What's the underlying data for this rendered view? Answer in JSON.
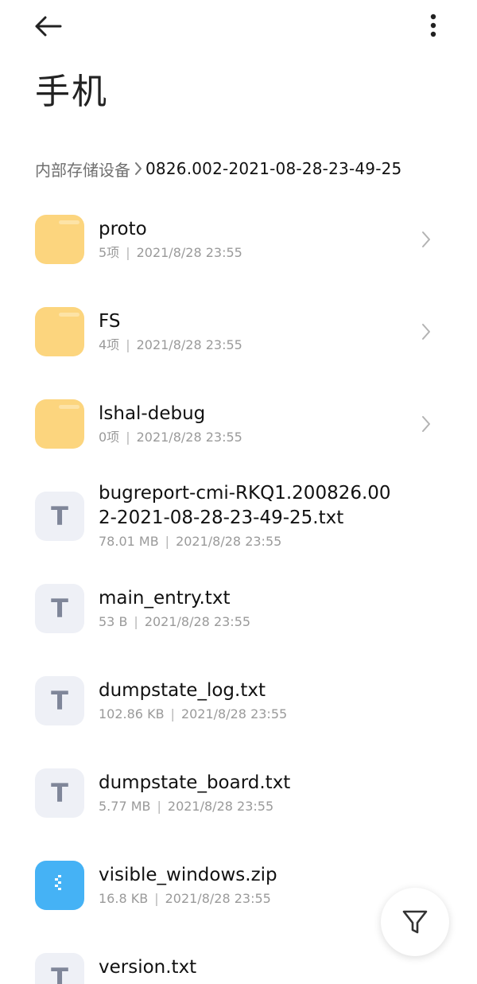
{
  "header": {
    "title": "手机",
    "back_icon": "arrow-left-icon",
    "more_icon": "more-vertical-icon"
  },
  "breadcrumb": {
    "root": "内部存储设备",
    "current": "0826.002-2021-08-28-23-49-25"
  },
  "files": [
    {
      "name": "proto",
      "size": "5项",
      "date": "2021/8/28 23:55",
      "kind": "folder"
    },
    {
      "name": "FS",
      "size": "4项",
      "date": "2021/8/28 23:55",
      "kind": "folder"
    },
    {
      "name": "lshal-debug",
      "size": "0项",
      "date": "2021/8/28 23:55",
      "kind": "folder"
    },
    {
      "name": "bugreport-cmi-RKQ1.200826.002-2021-08-28-23-49-25.txt",
      "size": "78.01 MB",
      "date": "2021/8/28 23:55",
      "kind": "txt"
    },
    {
      "name": "main_entry.txt",
      "size": "53 B",
      "date": "2021/8/28 23:55",
      "kind": "txt"
    },
    {
      "name": "dumpstate_log.txt",
      "size": "102.86 KB",
      "date": "2021/8/28 23:55",
      "kind": "txt"
    },
    {
      "name": "dumpstate_board.txt",
      "size": "5.77 MB",
      "date": "2021/8/28 23:55",
      "kind": "txt"
    },
    {
      "name": "visible_windows.zip",
      "size": "16.8 KB",
      "date": "2021/8/28 23:55",
      "kind": "zip"
    },
    {
      "name": "version.txt",
      "kind": "txt"
    }
  ],
  "meta_separator": "|",
  "icon_text": "T",
  "fab": {
    "icon": "filter-icon"
  },
  "colors": {
    "folder": "#fcd57e",
    "txt_bg": "#eef0f6",
    "txt_glyph": "#7f8699",
    "zip": "#45b2f5"
  }
}
